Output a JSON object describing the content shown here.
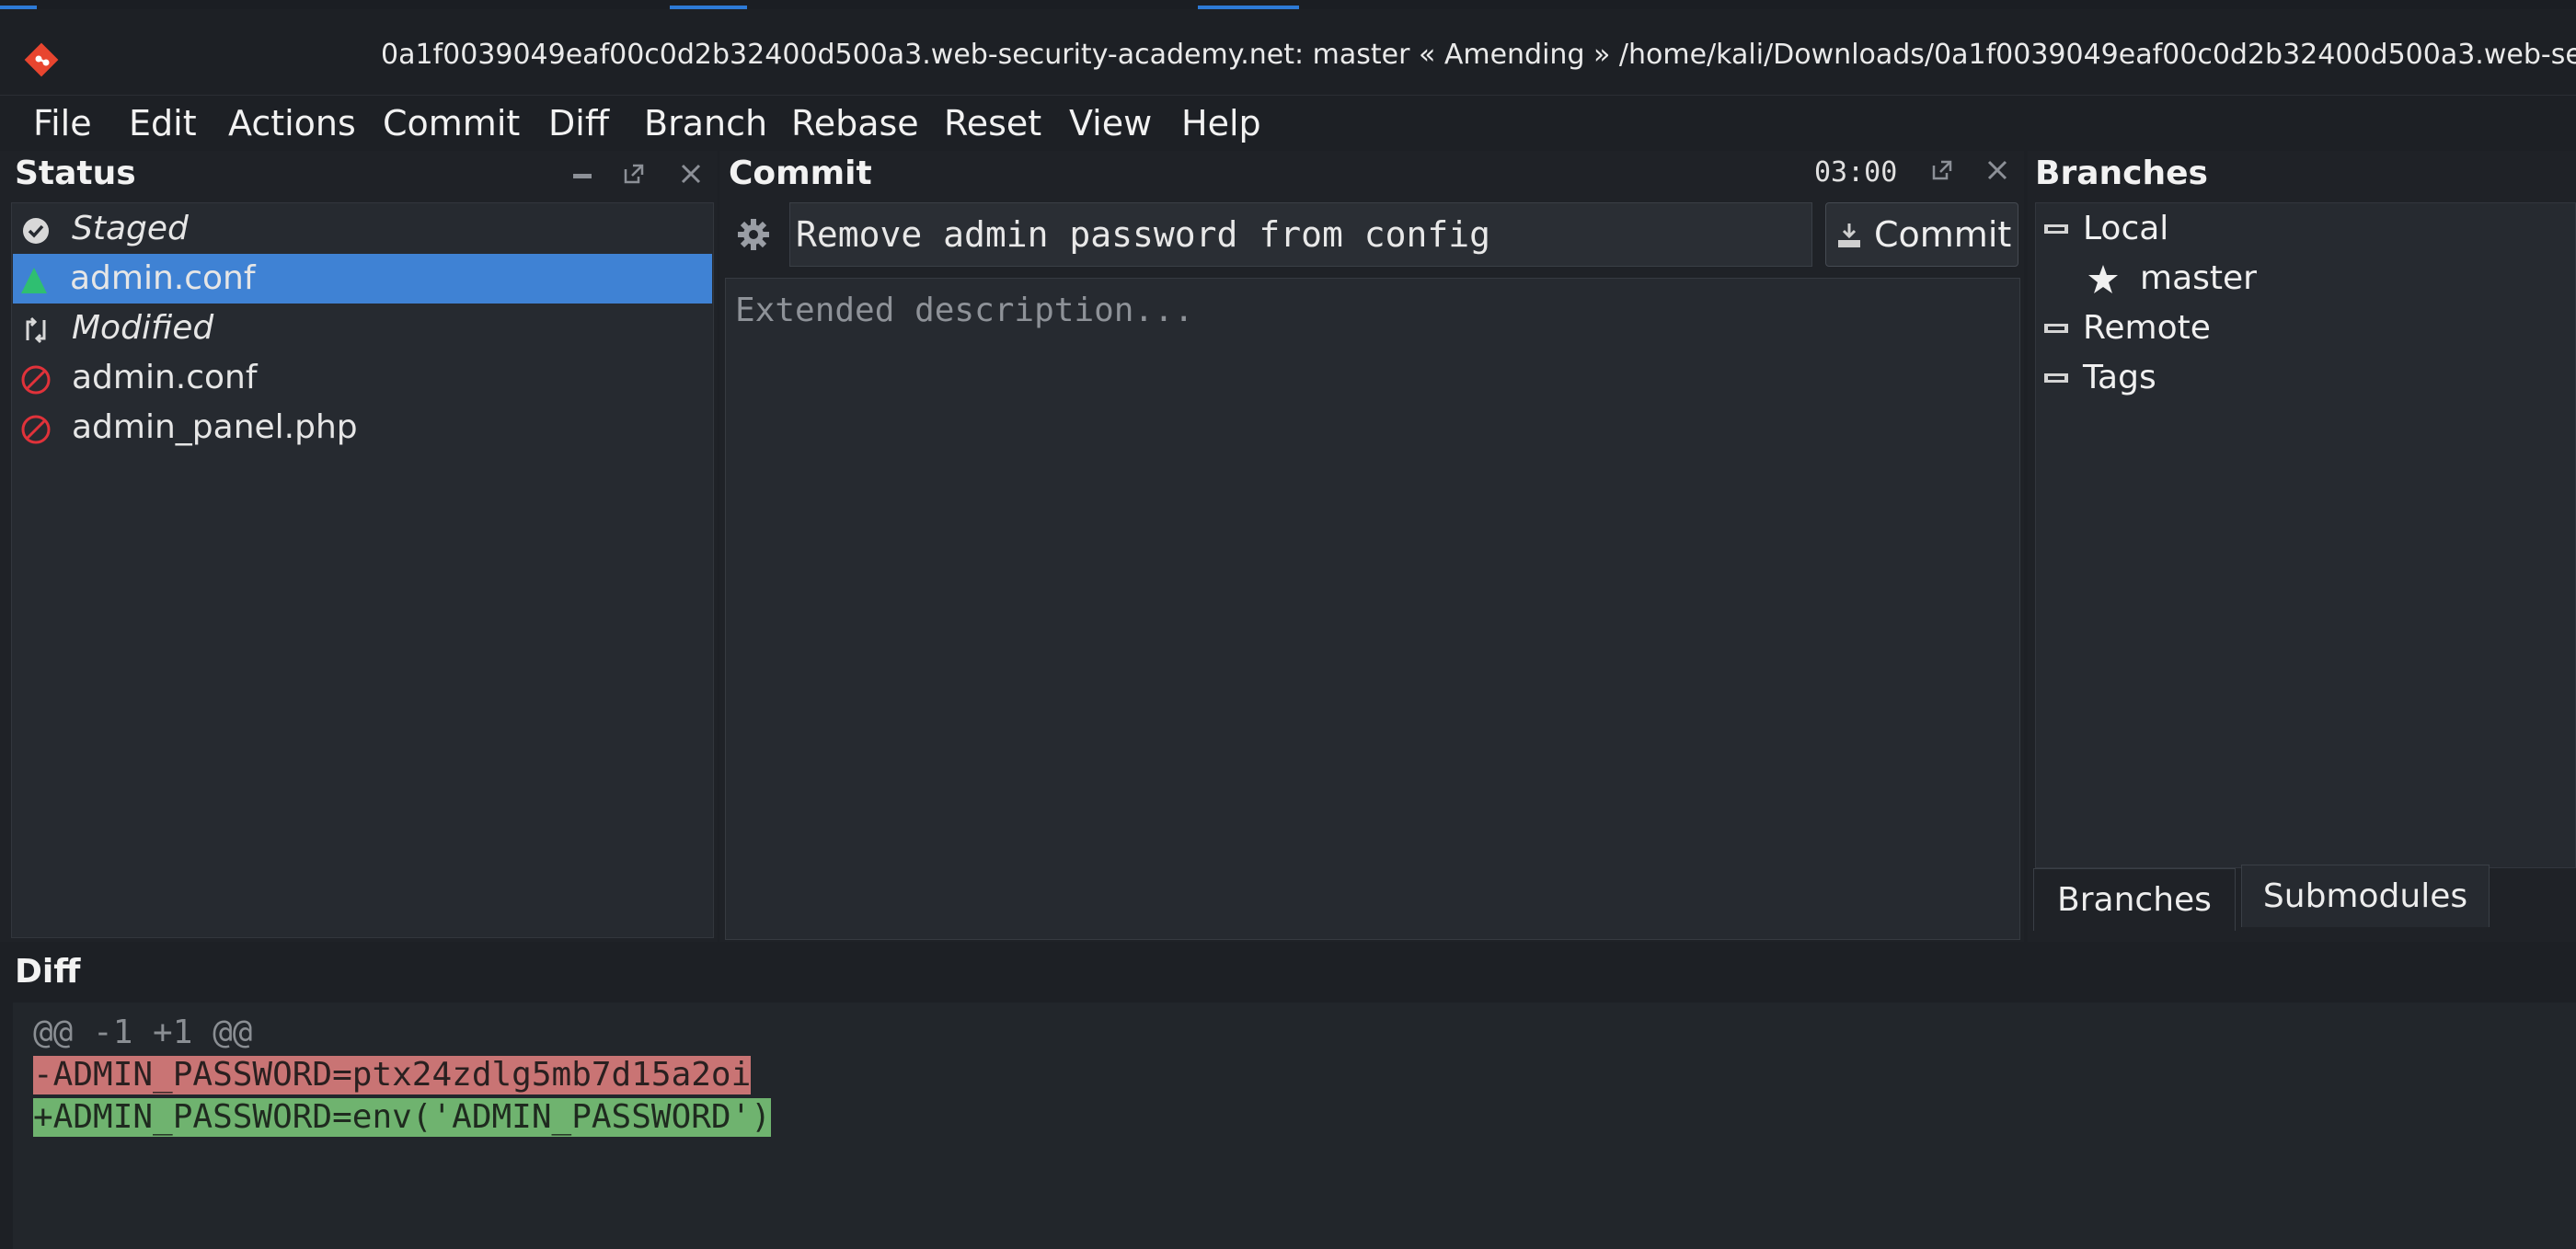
{
  "window": {
    "title": "0a1f0039049eaf00c0d2b32400d500a3.web-security-academy.net: master « Amending » /home/kali/Downloads/0a1f0039049eaf00c0d2b32400d500a3.web-securi"
  },
  "menubar": {
    "items": [
      "File",
      "Edit",
      "Actions",
      "Commit",
      "Diff",
      "Branch",
      "Rebase",
      "Reset",
      "View",
      "Help"
    ]
  },
  "status": {
    "title": "Status",
    "staged_label": "Staged",
    "staged_files": [
      "admin.conf"
    ],
    "modified_label": "Modified",
    "modified_files": [
      "admin.conf",
      "admin_panel.php"
    ]
  },
  "commit": {
    "title": "Commit",
    "timer": "03:00",
    "summary": "Remove admin password from config",
    "description_placeholder": "Extended description...",
    "button_label": "Commit"
  },
  "branches": {
    "title": "Branches",
    "local_label": "Local",
    "current_branch": "master",
    "remote_label": "Remote",
    "tags_label": "Tags",
    "tabs": [
      "Branches",
      "Submodules"
    ],
    "active_tab": "Branches"
  },
  "diff": {
    "title": "Diff",
    "hunk_header": "@@ -1 +1 @@",
    "removed_line": "-ADMIN_PASSWORD=ptx24zdlg5mb7d15a2oi",
    "added_line": "+ADMIN_PASSWORD=env('ADMIN_PASSWORD')"
  },
  "colors": {
    "selection": "#3f82d4",
    "diff_removed_bg": "#c97474",
    "diff_added_bg": "#6fb36f",
    "staged_icon": "#2fbf71",
    "modified_icon": "#e0323a",
    "app_icon": "#e8452f"
  },
  "icons": {
    "app": "git-cola-icon",
    "staged": "checkmark-icon",
    "added_file": "triangle-up-icon",
    "modified": "modified-arrows-icon",
    "unmerged": "prohibited-icon",
    "settings": "gear-icon",
    "commit_button": "download-icon",
    "branch_folder": "folder-icon",
    "current_branch": "star-icon"
  }
}
